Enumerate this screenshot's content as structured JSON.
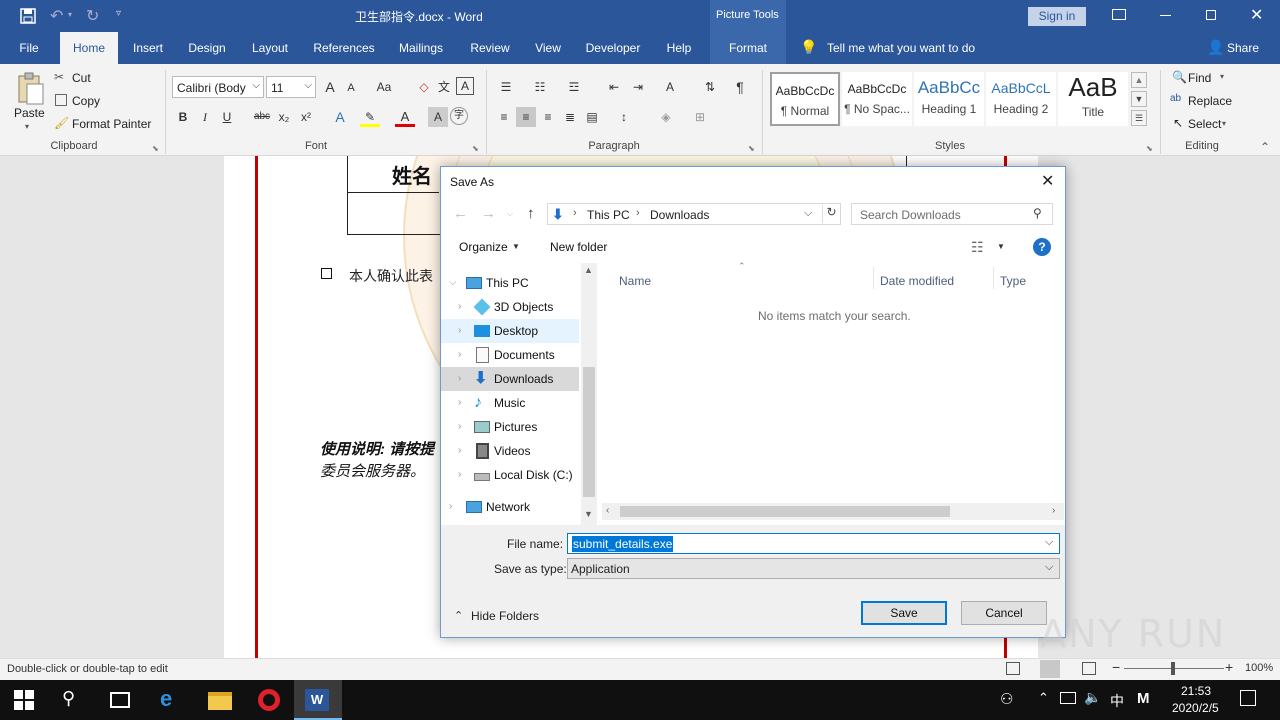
{
  "app": {
    "title": "卫生部指令.docx - Word",
    "context_tab_group": "Picture Tools",
    "sign_in": "Sign in",
    "share": "Share",
    "tell_me": "Tell me what you want to do"
  },
  "ribbon_tabs": [
    "File",
    "Home",
    "Insert",
    "Design",
    "Layout",
    "References",
    "Mailings",
    "Review",
    "View",
    "Developer",
    "Help",
    "Format"
  ],
  "clipboard": {
    "paste": "Paste",
    "cut": "Cut",
    "copy": "Copy",
    "format_painter": "Format Painter",
    "label": "Clipboard"
  },
  "font": {
    "name": "Calibri (Body",
    "size": "11",
    "label": "Font",
    "grow": "A",
    "shrink": "A",
    "case": "Aa"
  },
  "paragraph": {
    "label": "Paragraph"
  },
  "styles": {
    "label": "Styles",
    "items": [
      {
        "preview": "AaBbCcDc",
        "name": "¶ Normal"
      },
      {
        "preview": "AaBbCcDc",
        "name": "¶ No Spac..."
      },
      {
        "preview": "AaBbCc",
        "name": "Heading 1"
      },
      {
        "preview": "AaBbCcL",
        "name": "Heading 2"
      },
      {
        "preview": "AaB",
        "name": "Title"
      }
    ]
  },
  "editing": {
    "find": "Find",
    "replace": "Replace",
    "select": "Select",
    "label": "Editing"
  },
  "document": {
    "table_cell": "姓名",
    "checkbox_text": "本人确认此表",
    "instructions_line1": "使用说明: 请按提",
    "instructions_line2": "委员会服务器。"
  },
  "dialog": {
    "title": "Save As",
    "breadcrumb": [
      "This PC",
      "Downloads"
    ],
    "search_placeholder": "Search Downloads",
    "organize": "Organize",
    "new_folder": "New folder",
    "tree": [
      {
        "label": "This PC",
        "icon": "computer-icon",
        "level": 0
      },
      {
        "label": "3D Objects",
        "icon": "cube-icon",
        "level": 1
      },
      {
        "label": "Desktop",
        "icon": "desktop-icon",
        "level": 1
      },
      {
        "label": "Documents",
        "icon": "documents-icon",
        "level": 1
      },
      {
        "label": "Downloads",
        "icon": "download-icon",
        "level": 1
      },
      {
        "label": "Music",
        "icon": "music-icon",
        "level": 1
      },
      {
        "label": "Pictures",
        "icon": "pictures-icon",
        "level": 1
      },
      {
        "label": "Videos",
        "icon": "videos-icon",
        "level": 1
      },
      {
        "label": "Local Disk (C:)",
        "icon": "disk-icon",
        "level": 1
      },
      {
        "label": "Network",
        "icon": "network-icon",
        "level": 0
      }
    ],
    "columns": [
      "Name",
      "Date modified",
      "Type"
    ],
    "empty_message": "No items match your search.",
    "file_name_label": "File name:",
    "file_name_value": "submit_details.exe",
    "save_type_label": "Save as type:",
    "save_type_value": "Application",
    "hide_folders": "Hide Folders",
    "save_button": "Save",
    "cancel_button": "Cancel"
  },
  "statusbar": {
    "hint": "Double-click or double-tap to edit",
    "zoom": "100%"
  },
  "taskbar": {
    "time": "21:53",
    "date": "2020/2/5",
    "ime": "中",
    "ime2": "M"
  },
  "watermark": "ANY RUN",
  "colors": {
    "word_blue": "#2b579a",
    "selection": "#0078d7",
    "doc_red_line": "#c00000"
  }
}
